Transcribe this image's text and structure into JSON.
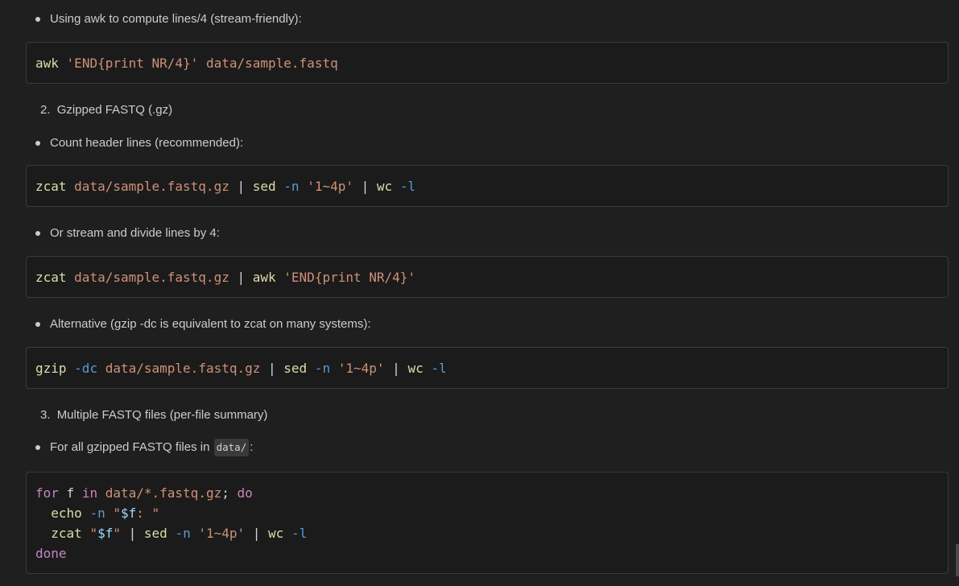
{
  "items": {
    "awk_bullet": "Using awk to compute lines/4 (stream-friendly):",
    "awk_code": [
      {
        "t": "awk",
        "c": "cmd"
      },
      {
        "t": " ",
        "c": "plain"
      },
      {
        "t": "'END{print NR/4}'",
        "c": "str"
      },
      {
        "t": " ",
        "c": "plain"
      },
      {
        "t": "data/sample.fastq",
        "c": "str"
      }
    ],
    "section2_number": "2.",
    "section2_title": "Gzipped FASTQ (.gz)",
    "count_bullet": "Count header lines (recommended):",
    "count_code": [
      {
        "t": "zcat",
        "c": "cmd"
      },
      {
        "t": " ",
        "c": "plain"
      },
      {
        "t": "data/sample.fastq.gz",
        "c": "str"
      },
      {
        "t": " | ",
        "c": "plain"
      },
      {
        "t": "sed",
        "c": "cmd"
      },
      {
        "t": " ",
        "c": "plain"
      },
      {
        "t": "-n",
        "c": "flag"
      },
      {
        "t": " ",
        "c": "plain"
      },
      {
        "t": "'1~4p'",
        "c": "str"
      },
      {
        "t": " | ",
        "c": "plain"
      },
      {
        "t": "wc",
        "c": "cmd"
      },
      {
        "t": " ",
        "c": "plain"
      },
      {
        "t": "-l",
        "c": "flag"
      }
    ],
    "stream_bullet": "Or stream and divide lines by 4:",
    "stream_code": [
      {
        "t": "zcat",
        "c": "cmd"
      },
      {
        "t": " ",
        "c": "plain"
      },
      {
        "t": "data/sample.fastq.gz",
        "c": "str"
      },
      {
        "t": " | ",
        "c": "plain"
      },
      {
        "t": "awk",
        "c": "cmd"
      },
      {
        "t": " ",
        "c": "plain"
      },
      {
        "t": "'END{print NR/4}'",
        "c": "str"
      }
    ],
    "alt_bullet": "Alternative (gzip -dc is equivalent to zcat on many systems):",
    "alt_code": [
      {
        "t": "gzip",
        "c": "cmd"
      },
      {
        "t": " ",
        "c": "plain"
      },
      {
        "t": "-dc",
        "c": "flag"
      },
      {
        "t": " ",
        "c": "plain"
      },
      {
        "t": "data/sample.fastq.gz",
        "c": "str"
      },
      {
        "t": " | ",
        "c": "plain"
      },
      {
        "t": "sed",
        "c": "cmd"
      },
      {
        "t": " ",
        "c": "plain"
      },
      {
        "t": "-n",
        "c": "flag"
      },
      {
        "t": " ",
        "c": "plain"
      },
      {
        "t": "'1~4p'",
        "c": "str"
      },
      {
        "t": " | ",
        "c": "plain"
      },
      {
        "t": "wc",
        "c": "cmd"
      },
      {
        "t": " ",
        "c": "plain"
      },
      {
        "t": "-l",
        "c": "flag"
      }
    ],
    "section3_number": "3.",
    "section3_title": "Multiple FASTQ files (per-file summary)",
    "multi_bullet_prefix": "For all gzipped FASTQ files in",
    "multi_bullet_code": "data/",
    "multi_bullet_suffix": ":",
    "multi_code": [
      {
        "t": "for",
        "c": "kw"
      },
      {
        "t": " f ",
        "c": "plain"
      },
      {
        "t": "in",
        "c": "kw"
      },
      {
        "t": " ",
        "c": "plain"
      },
      {
        "t": "data/*.fastq.gz",
        "c": "str"
      },
      {
        "t": "; ",
        "c": "plain"
      },
      {
        "t": "do",
        "c": "kw"
      },
      {
        "t": "\n  ",
        "c": "plain"
      },
      {
        "t": "echo",
        "c": "cmd"
      },
      {
        "t": " ",
        "c": "plain"
      },
      {
        "t": "-n",
        "c": "flag"
      },
      {
        "t": " ",
        "c": "plain"
      },
      {
        "t": "\"",
        "c": "str"
      },
      {
        "t": "$f",
        "c": "var"
      },
      {
        "t": ": \"",
        "c": "str"
      },
      {
        "t": "\n  ",
        "c": "plain"
      },
      {
        "t": "zcat",
        "c": "cmd"
      },
      {
        "t": " ",
        "c": "plain"
      },
      {
        "t": "\"",
        "c": "str"
      },
      {
        "t": "$f",
        "c": "var"
      },
      {
        "t": "\"",
        "c": "str"
      },
      {
        "t": " | ",
        "c": "plain"
      },
      {
        "t": "sed",
        "c": "cmd"
      },
      {
        "t": " ",
        "c": "plain"
      },
      {
        "t": "-n",
        "c": "flag"
      },
      {
        "t": " ",
        "c": "plain"
      },
      {
        "t": "'1~4p'",
        "c": "str"
      },
      {
        "t": " | ",
        "c": "plain"
      },
      {
        "t": "wc",
        "c": "cmd"
      },
      {
        "t": " ",
        "c": "plain"
      },
      {
        "t": "-l",
        "c": "flag"
      },
      {
        "t": "\n",
        "c": "plain"
      },
      {
        "t": "done",
        "c": "kw"
      }
    ]
  }
}
